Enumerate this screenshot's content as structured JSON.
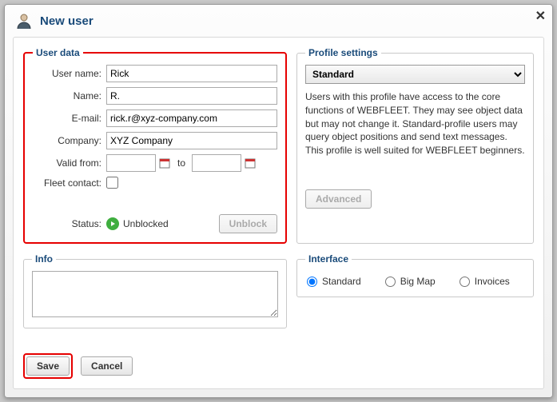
{
  "title": "New user",
  "user_data": {
    "legend": "User data",
    "username_label": "User name:",
    "username_value": "Rick",
    "name_label": "Name:",
    "name_value": "R.",
    "email_label": "E-mail:",
    "email_value": "rick.r@xyz-company.com",
    "company_label": "Company:",
    "company_value": "XYZ Company",
    "valid_from_label": "Valid from:",
    "valid_from_value": "",
    "to_label": "to",
    "valid_to_value": "",
    "fleet_contact_label": "Fleet contact:",
    "status_label": "Status:",
    "status_text": "Unblocked",
    "unblock_btn": "Unblock"
  },
  "info": {
    "legend": "Info",
    "value": ""
  },
  "profile": {
    "legend": "Profile settings",
    "selected": "Standard",
    "description": "Users with this profile have access to the core functions of WEBFLEET. They may see object data but may not change it. Standard-profile users may query object positions and send text messages. This profile is well suited for WEBFLEET beginners.",
    "advanced_btn": "Advanced"
  },
  "interface": {
    "legend": "Interface",
    "options": [
      "Standard",
      "Big Map",
      "Invoices"
    ],
    "selected": "Standard"
  },
  "buttons": {
    "save": "Save",
    "cancel": "Cancel"
  }
}
